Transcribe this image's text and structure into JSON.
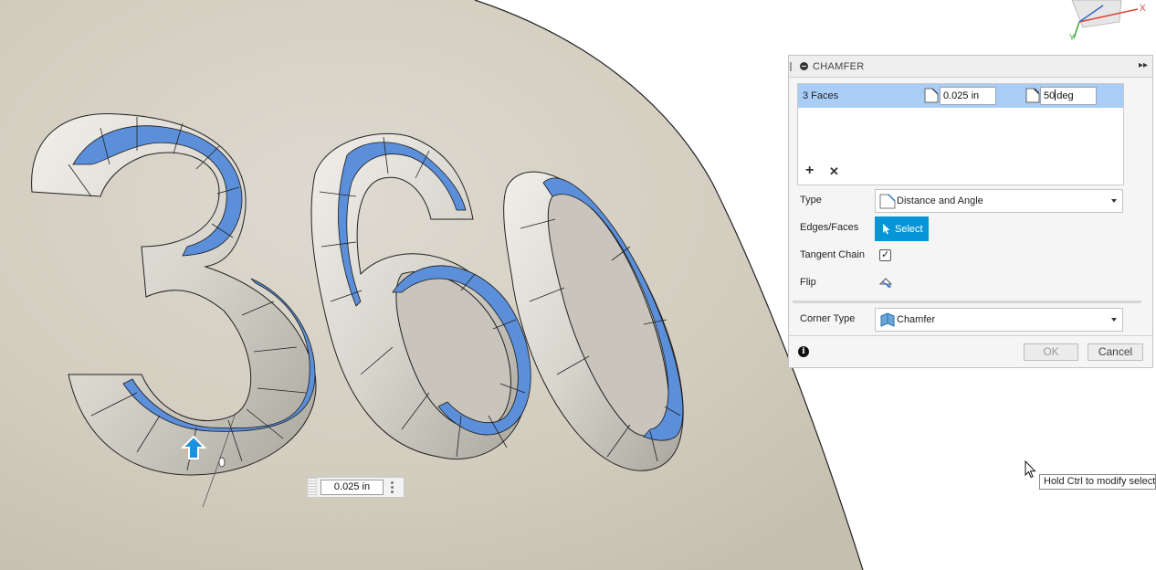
{
  "dialog": {
    "title": "CHAMFER",
    "selection": {
      "label": "3 Faces",
      "distance": "0.025 in",
      "angle_value": "50",
      "angle_unit": "deg"
    },
    "add_symbol": "+",
    "remove_symbol": "✕",
    "type": {
      "label": "Type",
      "value": "Distance and Angle"
    },
    "edges_faces": {
      "label": "Edges/Faces",
      "button": "Select"
    },
    "tangent_chain": {
      "label": "Tangent Chain",
      "checked": true,
      "mark": "✓"
    },
    "flip": {
      "label": "Flip"
    },
    "corner_type": {
      "label": "Corner Type",
      "value": "Chamfer"
    },
    "info_symbol": "i",
    "ok_label": "OK",
    "cancel_label": "Cancel",
    "expand_symbol": "▸▸"
  },
  "canvas": {
    "distance_input": "0.025 in",
    "model_text": "360"
  },
  "tooltip": "Hold Ctrl to modify selection",
  "viewcube": {
    "axis_x": "X",
    "axis_y": "Y"
  },
  "colors": {
    "selection_row": "#a9cdf6",
    "select_button": "#0696d7",
    "face_highlight": "#5b8fd9",
    "surface": "#d8d3c6"
  }
}
